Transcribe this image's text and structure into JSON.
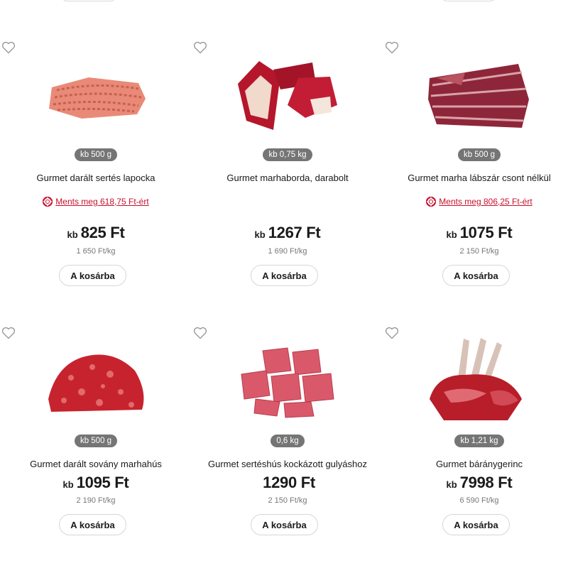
{
  "cart_button_label": "A kosárba",
  "prefix_kb": "kb",
  "products": [
    {
      "name": "Gurmet darált sertés lapocka",
      "weight_badge": "kb 500 g",
      "savings": "Ments meg 618,75 Ft-ért",
      "price_prefix": "kb",
      "price": "825 Ft",
      "unit_price": "1 650 Ft/kg",
      "image": "ground-pork-icon"
    },
    {
      "name": "Gurmet marhaborda, darabolt",
      "weight_badge": "kb 0,75 kg",
      "savings": "",
      "price_prefix": "kb",
      "price": "1267 Ft",
      "unit_price": "1 690 Ft/kg",
      "image": "beef-ribs-icon"
    },
    {
      "name": "Gurmet marha lábszár csont nélkül",
      "weight_badge": "kb 500 g",
      "savings": "Ments meg 806,25 Ft-ért",
      "price_prefix": "kb",
      "price": "1075 Ft",
      "unit_price": "2 150 Ft/kg",
      "image": "beef-shank-icon"
    },
    {
      "name": "Gurmet darált sovány marhahús",
      "weight_badge": "kb 500 g",
      "savings": "",
      "price_prefix": "kb",
      "price": "1095 Ft",
      "unit_price": "2 190 Ft/kg",
      "image": "ground-beef-icon"
    },
    {
      "name": "Gurmet sertéshús kockázott gulyáshoz",
      "weight_badge": "0,6 kg",
      "savings": "",
      "price_prefix": "",
      "price": "1290 Ft",
      "unit_price": "2 150 Ft/kg",
      "image": "diced-pork-icon"
    },
    {
      "name": "Gurmet báránygerinc",
      "weight_badge": "kb 1,21 kg",
      "savings": "",
      "price_prefix": "kb",
      "price": "7998 Ft",
      "unit_price": "6 590 Ft/kg",
      "image": "lamb-rack-icon"
    }
  ]
}
